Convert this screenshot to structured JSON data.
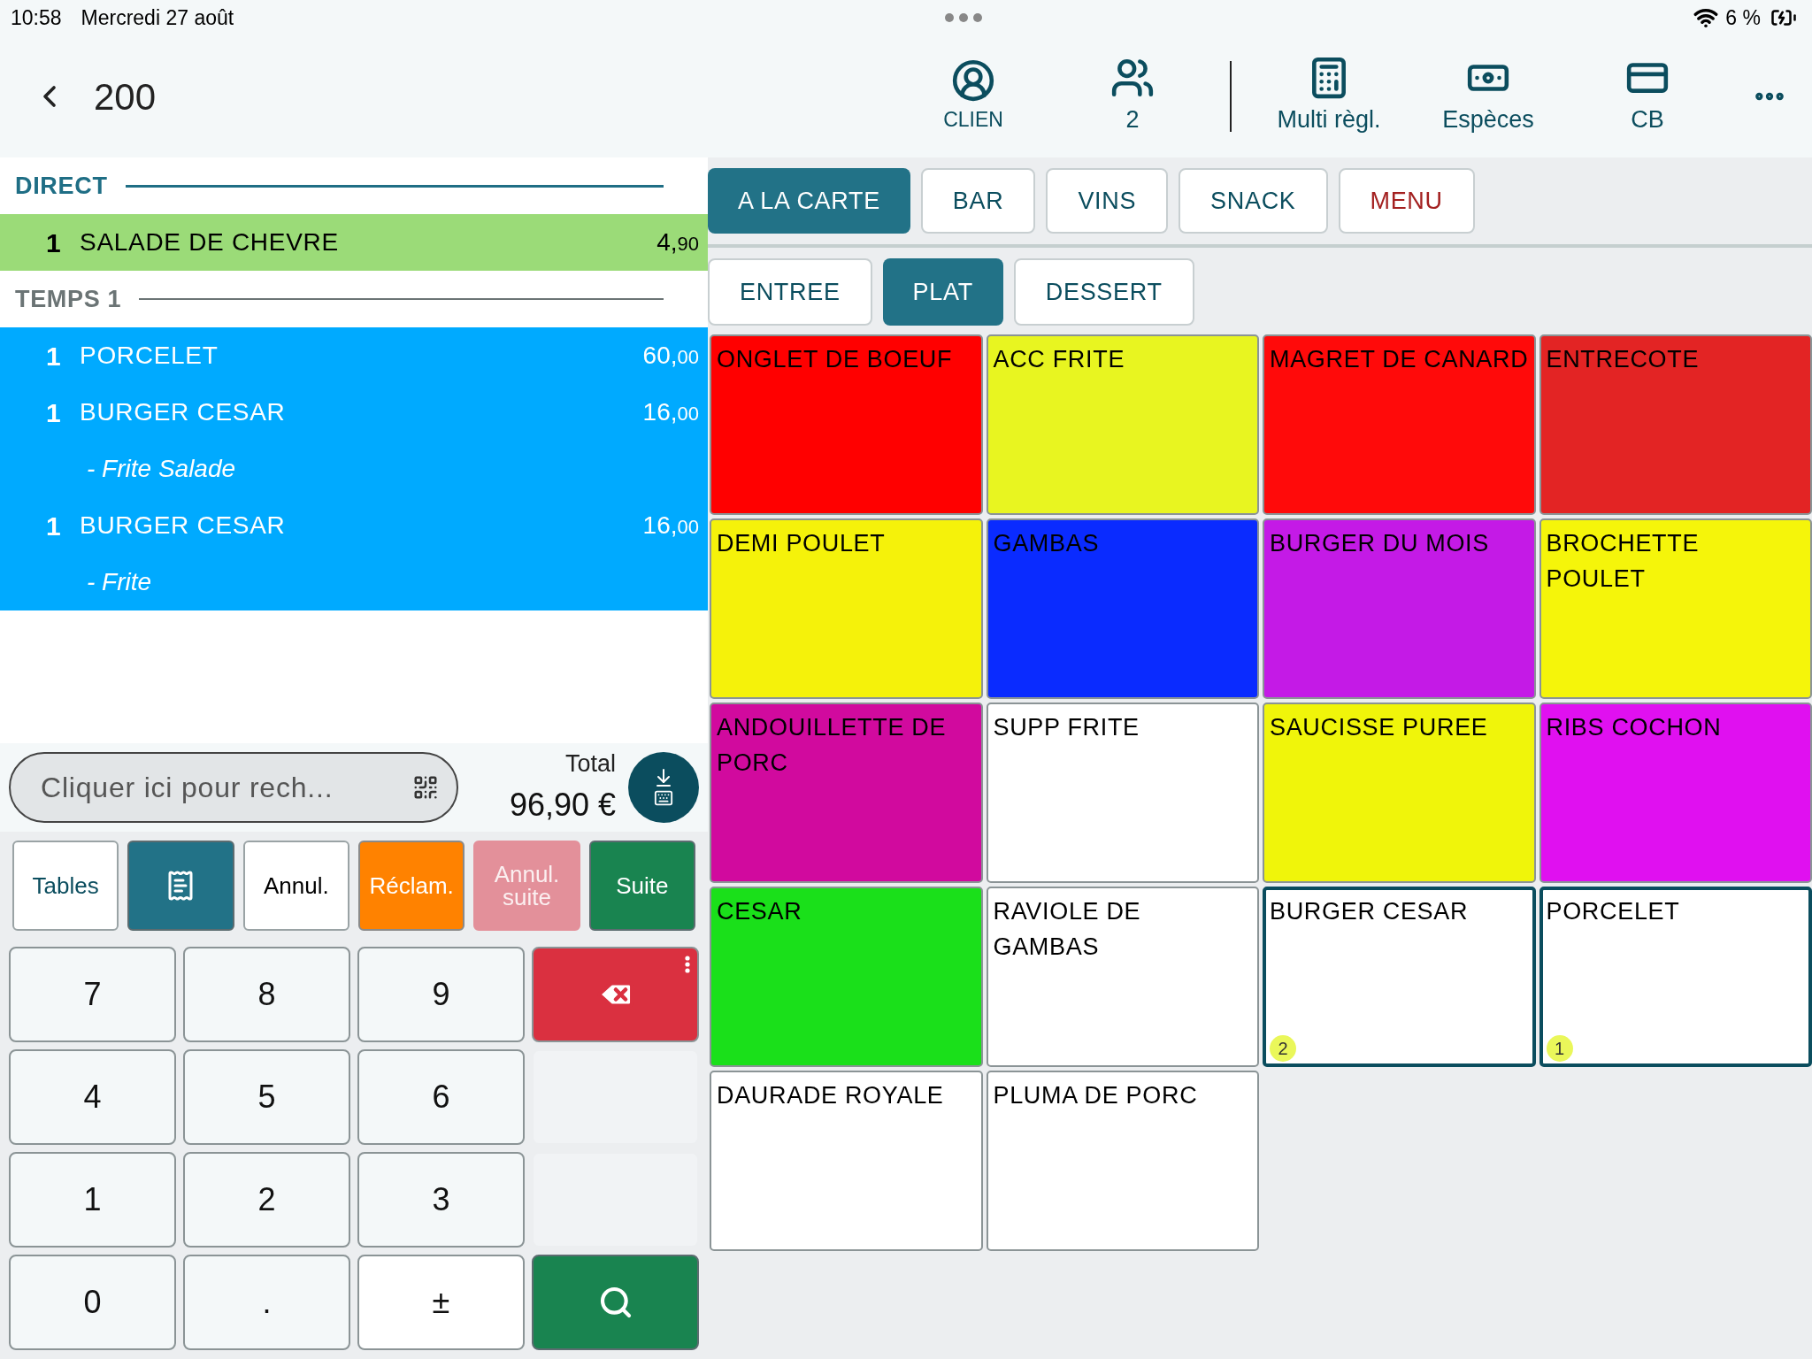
{
  "status_bar": {
    "time": "10:58",
    "date": "Mercredi 27 août",
    "battery": "6 %"
  },
  "header": {
    "title": "200",
    "actions": [
      {
        "kind": "client",
        "label": "CLIEN"
      },
      {
        "kind": "guests",
        "label": "2"
      },
      {
        "kind": "multi",
        "label": "Multi règl."
      },
      {
        "kind": "cash",
        "label": "Espèces"
      },
      {
        "kind": "card",
        "label": "CB"
      }
    ]
  },
  "order": {
    "groups": [
      {
        "title": "DIRECT",
        "active": true,
        "color": "#9bdb78",
        "lines": [
          {
            "qty": "1",
            "name": "SALADE DE CHEVRE",
            "price": "4,90"
          }
        ]
      },
      {
        "title": "TEMPS 1",
        "active": false,
        "color": "#00aaff",
        "lines": [
          {
            "qty": "1",
            "name": "PORCELET",
            "price": "60,00"
          },
          {
            "qty": "1",
            "name": "BURGER CESAR",
            "price": "16,00",
            "note": "- Frite Salade"
          },
          {
            "qty": "1",
            "name": "BURGER CESAR",
            "price": "16,00",
            "note": "- Frite"
          }
        ]
      }
    ]
  },
  "search": {
    "placeholder": "Cliquer ici pour rech..."
  },
  "total": {
    "label": "Total",
    "amount": "96,90 €"
  },
  "actions": [
    {
      "kind": "outline",
      "label": "Tables"
    },
    {
      "kind": "icon"
    },
    {
      "kind": "plain",
      "label": "Annul."
    },
    {
      "kind": "warning",
      "label": "Réclam."
    },
    {
      "kind": "disabled",
      "label": "Annul. suite"
    },
    {
      "kind": "primary",
      "label": "Suite"
    }
  ],
  "keypad": [
    {
      "kind": "digit",
      "label": "7"
    },
    {
      "kind": "digit",
      "label": "8"
    },
    {
      "kind": "digit",
      "label": "9"
    },
    {
      "kind": "delete"
    },
    {
      "kind": "digit",
      "label": "4"
    },
    {
      "kind": "digit",
      "label": "5"
    },
    {
      "kind": "digit",
      "label": "6"
    },
    {
      "kind": "blank"
    },
    {
      "kind": "digit",
      "label": "1"
    },
    {
      "kind": "digit",
      "label": "2"
    },
    {
      "kind": "digit",
      "label": "3"
    },
    {
      "kind": "blank"
    },
    {
      "kind": "digit",
      "label": "0"
    },
    {
      "kind": "digit",
      "label": "."
    },
    {
      "kind": "sign",
      "label": "±"
    },
    {
      "kind": "search"
    }
  ],
  "categories": [
    {
      "label": "A LA CARTE",
      "selected": true
    },
    {
      "label": "BAR",
      "selected": false
    },
    {
      "label": "VINS",
      "selected": false
    },
    {
      "label": "SNACK",
      "selected": false
    },
    {
      "label": "MENU",
      "selected": false,
      "kind": "menu"
    }
  ],
  "subcategories": [
    {
      "label": "ENTREE",
      "selected": false
    },
    {
      "label": "PLAT",
      "selected": true
    },
    {
      "label": "DESSERT",
      "selected": false
    }
  ],
  "products": [
    {
      "name": "ONGLET DE BOEUF",
      "color": "#ff0000"
    },
    {
      "name": "ACC FRITE",
      "color": "#e8f520"
    },
    {
      "name": "MAGRET DE CANARD",
      "color": "#ff0a0a"
    },
    {
      "name": "ENTRECOTE",
      "color": "#e32424"
    },
    {
      "name": "DEMI POULET",
      "color": "#f5f20a"
    },
    {
      "name": "GAMBAS",
      "color": "#0a2bff"
    },
    {
      "name": "BURGER DU MOIS",
      "color": "#c41ae6"
    },
    {
      "name": "BROCHETTE POULET",
      "color": "#f5f50a"
    },
    {
      "name": "ANDOUILLETTE DE PORC",
      "color": "#d10a9e"
    },
    {
      "name": "SUPP FRITE",
      "color": "#ffffff"
    },
    {
      "name": "SAUCISSE PUREE",
      "color": "#f0f50a"
    },
    {
      "name": "RIBS COCHON",
      "color": "#e010f0"
    },
    {
      "name": "CESAR",
      "color": "#1ae01a"
    },
    {
      "name": "RAVIOLE DE GAMBAS",
      "color": "#ffffff"
    },
    {
      "name": "BURGER CESAR",
      "color": "#ffffff",
      "count": "2"
    },
    {
      "name": "PORCELET",
      "color": "#ffffff",
      "count": "1"
    },
    {
      "name": "DAURADE ROYALE",
      "color": "#ffffff"
    },
    {
      "name": "PLUMA DE PORC",
      "color": "#ffffff"
    }
  ]
}
